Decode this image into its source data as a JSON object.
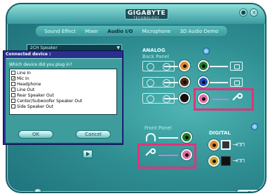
{
  "window": {
    "brand": "GIGABYTE",
    "brand_sub": "TECHNOLOGY",
    "minimize_label": "●",
    "close_label": "×"
  },
  "tabs": [
    {
      "label": "Sound Effect",
      "active": false
    },
    {
      "label": "Mixer",
      "active": false
    },
    {
      "label": "Audio I/O",
      "active": true
    },
    {
      "label": "Microphone",
      "active": false
    },
    {
      "label": "3D Audio Demo",
      "active": false
    }
  ],
  "speaker_config": {
    "value": "2CH Speaker"
  },
  "analog": {
    "title": "ANALOG",
    "back_panel_title": "Back Panel",
    "jacks": [
      {
        "color": "#e08a2a"
      },
      {
        "color": "#1c7d2a"
      },
      {
        "color": "#4a2a10"
      },
      {
        "color": "#1d4fc4"
      },
      {
        "color": "#111111"
      },
      {
        "color": "#e06aa0"
      }
    ]
  },
  "front_panel": {
    "title": "Front Panel",
    "jacks": [
      {
        "color": "#1c7d2a"
      },
      {
        "color": "#e06aa0"
      }
    ]
  },
  "digital": {
    "title": "DIGITAL"
  },
  "dialog": {
    "title": "Connected device :",
    "question": "Which device did you plug in?",
    "choices": [
      {
        "label": "Line In",
        "checked": false
      },
      {
        "label": "Mic In",
        "checked": true
      },
      {
        "label": "Headphone",
        "checked": false
      },
      {
        "label": "Line Out",
        "checked": false
      },
      {
        "label": "Rear Speaker Out",
        "checked": false
      },
      {
        "label": "Center/Subwoofer Speaker Out",
        "checked": false
      },
      {
        "label": "Side Speaker Out",
        "checked": false
      }
    ],
    "ok_label": "OK",
    "cancel_label": "Cancel"
  },
  "footer": {
    "ok_label": "OK"
  },
  "colors": {
    "highlight": "#e3327a",
    "panel": "#2f8e92",
    "dialog_title": "#2b2f8e"
  }
}
